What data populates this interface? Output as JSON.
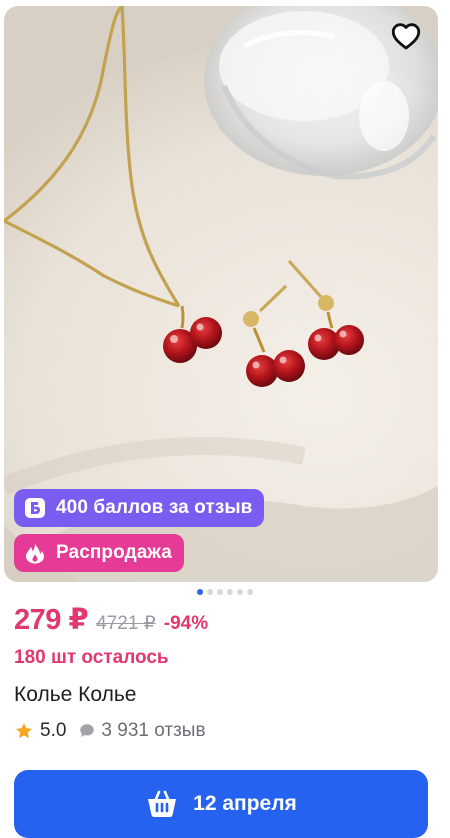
{
  "product": {
    "image_alt": "Cherry pendant necklace and earrings",
    "favorite_icon": "heart-outline-icon",
    "points_badge": {
      "icon": "points-b-icon",
      "label": "400 баллов за отзыв",
      "color": "#7b5cf0"
    },
    "sale_badge": {
      "icon": "fire-icon",
      "label": "Распродажа",
      "color": "#e53a95"
    },
    "gallery": {
      "count": 6,
      "active": 0
    },
    "price": "279 ₽",
    "old_price": "4721 ₽",
    "discount": "-94%",
    "stock": "180 шт осталось",
    "title": "Колье Колье",
    "rating": "5.0",
    "reviews": "3 931 отзыв",
    "cart_button": {
      "icon": "basket-icon",
      "label": "12 апреля",
      "color": "#2662f0"
    },
    "accent_color": "#e2386f"
  }
}
